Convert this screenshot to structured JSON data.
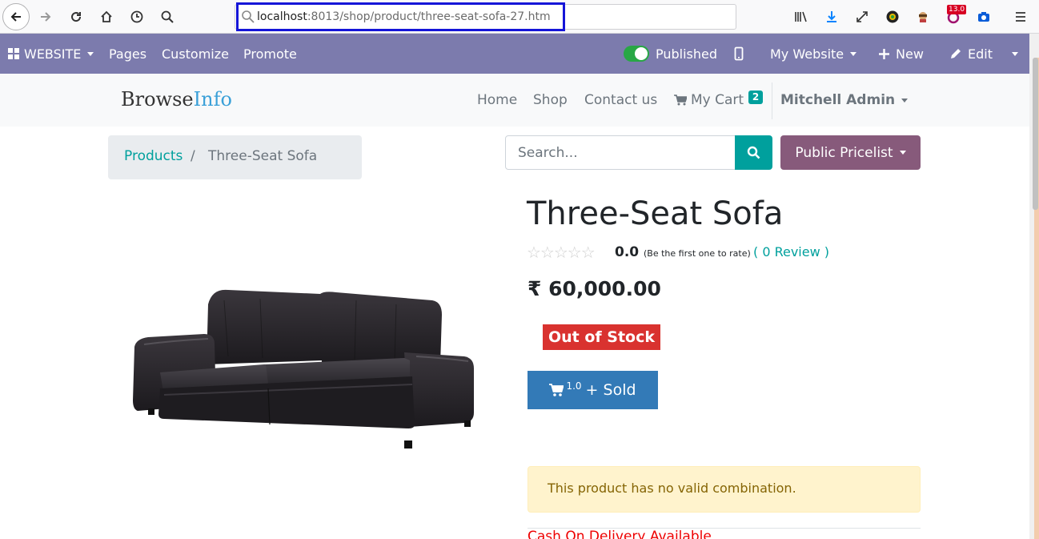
{
  "browser": {
    "url_host": "localhost",
    "url_rest": ":8013/shop/product/three-seat-sofa-27.htm",
    "badge_count": "13.0"
  },
  "admin_bar": {
    "website_label": "WEBSITE",
    "pages_label": "Pages",
    "customize_label": "Customize",
    "promote_label": "Promote",
    "published_label": "Published",
    "my_website_label": "My Website",
    "new_label": "New",
    "edit_label": "Edit"
  },
  "site": {
    "logo_part1": "Browse",
    "logo_part2": "Info",
    "nav_home": "Home",
    "nav_shop": "Shop",
    "nav_contact": "Contact us",
    "nav_cart": "My Cart",
    "cart_count": "2",
    "user_name": "Mitchell Admin"
  },
  "breadcrumb": {
    "link": "Products",
    "separator": "/",
    "current": "Three-Seat Sofa"
  },
  "search": {
    "placeholder": "Search...",
    "pricelist_label": "Public Pricelist"
  },
  "product": {
    "title": "Three-Seat Sofa",
    "rating_value": "0.0",
    "rating_note": "(Be the first one to rate)",
    "review_link": "( 0 Review )",
    "price": "₹ 60,000.00",
    "stock_status": "Out of Stock",
    "sold_qty": "1.0",
    "sold_label": "+ Sold",
    "alert": "This product has no valid combination.",
    "cod_text": "Cash On Delivery Available"
  },
  "colors": {
    "admin_bar": "#7c7bad",
    "brand_teal": "#00a09d",
    "pricelist": "#875a7b",
    "stock_red": "#d9322f",
    "sold_blue": "#337ab7"
  }
}
